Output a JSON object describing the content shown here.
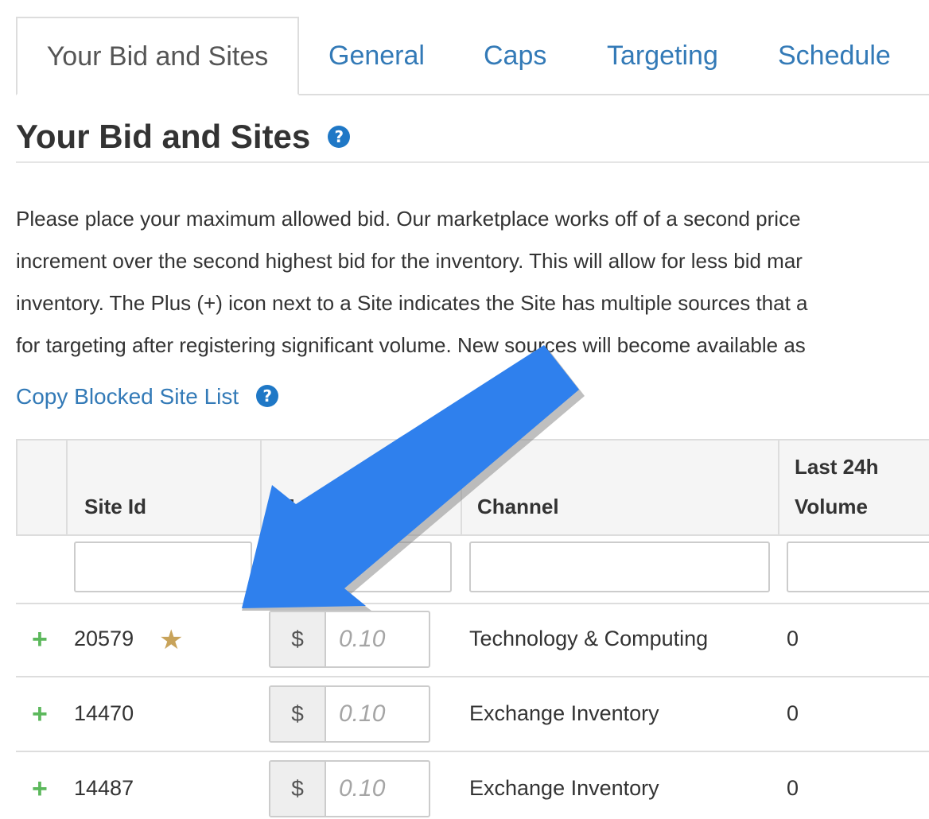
{
  "tabs": [
    {
      "label": "Your Bid and Sites",
      "active": true
    },
    {
      "label": "General",
      "active": false
    },
    {
      "label": "Caps",
      "active": false
    },
    {
      "label": "Targeting",
      "active": false
    },
    {
      "label": "Schedule",
      "active": false
    }
  ],
  "section": {
    "title": "Your Bid and Sites",
    "help_icon": "?",
    "description_lines": [
      "Please place your maximum allowed bid. Our marketplace works off of a second price",
      "increment over the second highest bid for the inventory. This will allow for less bid mar",
      "inventory. The Plus (+) icon next to a Site indicates the Site has multiple sources that a",
      "for targeting after registering significant volume. New sources will become available as"
    ],
    "copy_link": "Copy Blocked Site List",
    "copy_help_icon": "?"
  },
  "table": {
    "headers": {
      "site_id": "Site Id",
      "max_bid": "Max",
      "channel": "Channel",
      "volume_line1": "Last 24h",
      "volume_line2": "Volume"
    },
    "rows": [
      {
        "expand": "+",
        "site_id": "20579",
        "starred": true,
        "currency": "$",
        "bid_placeholder": "0.10",
        "channel": "Technology & Computing",
        "volume": "0"
      },
      {
        "expand": "+",
        "site_id": "14470",
        "starred": false,
        "currency": "$",
        "bid_placeholder": "0.10",
        "channel": "Exchange Inventory",
        "volume": "0"
      },
      {
        "expand": "+",
        "site_id": "14487",
        "starred": false,
        "currency": "$",
        "bid_placeholder": "0.10",
        "channel": "Exchange Inventory",
        "volume": "0"
      }
    ]
  },
  "colors": {
    "link": "#337ab7",
    "help_icon": "#1f78c6",
    "plus": "#5cb85c",
    "star": "#c8a35a",
    "arrow": "#2f80ed"
  },
  "icons": {
    "expand": "plus-icon",
    "favorite": "star-icon",
    "help": "question-circle-icon",
    "annotation": "arrow-annotation"
  }
}
